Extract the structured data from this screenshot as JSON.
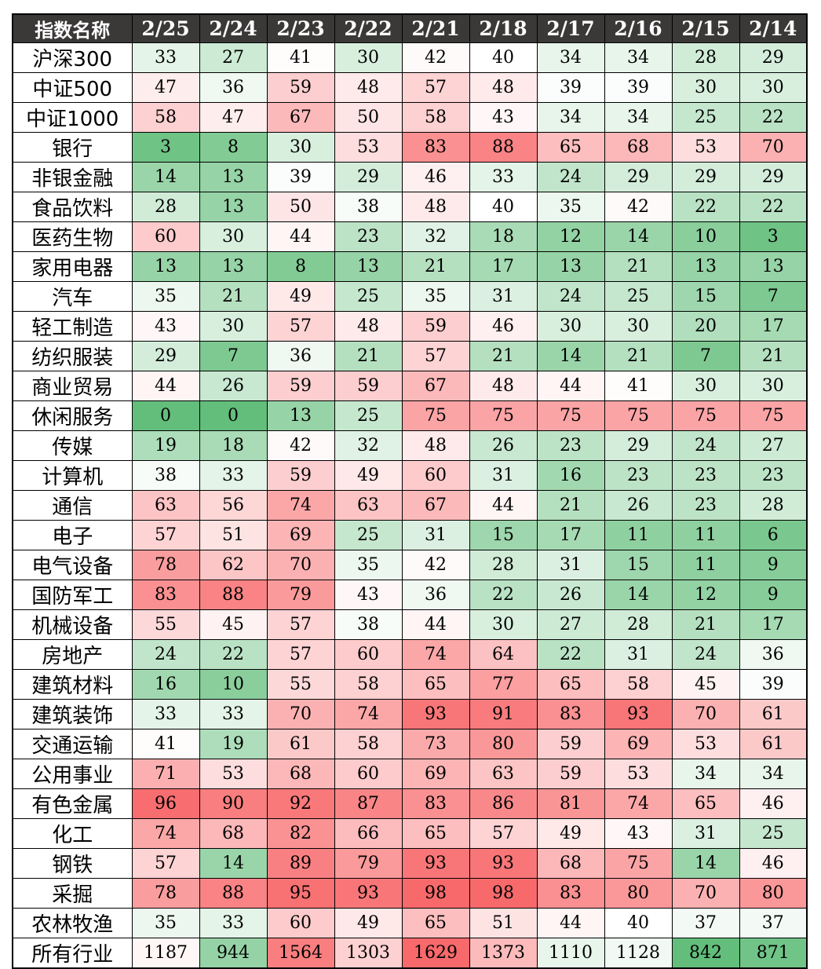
{
  "chart_data": {
    "type": "heatmap",
    "corner_label": "指数名称",
    "columns": [
      "2/25",
      "2/24",
      "2/23",
      "2/22",
      "2/21",
      "2/18",
      "2/17",
      "2/16",
      "2/15",
      "2/14"
    ],
    "rows": [
      {
        "name": "沪深300",
        "values": [
          33,
          27,
          41,
          30,
          42,
          40,
          34,
          34,
          28,
          29
        ]
      },
      {
        "name": "中证500",
        "values": [
          47,
          36,
          59,
          48,
          57,
          48,
          39,
          39,
          30,
          30
        ]
      },
      {
        "name": "中证1000",
        "values": [
          58,
          47,
          67,
          50,
          58,
          43,
          34,
          34,
          25,
          22
        ]
      },
      {
        "name": "银行",
        "values": [
          3,
          8,
          30,
          53,
          83,
          88,
          65,
          68,
          53,
          70
        ]
      },
      {
        "name": "非银金融",
        "values": [
          14,
          13,
          39,
          29,
          46,
          33,
          24,
          29,
          29,
          29
        ]
      },
      {
        "name": "食品饮料",
        "values": [
          28,
          13,
          50,
          38,
          48,
          40,
          35,
          42,
          22,
          22
        ]
      },
      {
        "name": "医药生物",
        "values": [
          60,
          30,
          44,
          23,
          32,
          18,
          12,
          14,
          10,
          3
        ]
      },
      {
        "name": "家用电器",
        "values": [
          13,
          13,
          8,
          13,
          21,
          17,
          13,
          21,
          13,
          13
        ]
      },
      {
        "name": "汽车",
        "values": [
          35,
          21,
          49,
          25,
          35,
          31,
          24,
          25,
          15,
          7
        ]
      },
      {
        "name": "轻工制造",
        "values": [
          43,
          30,
          57,
          48,
          59,
          46,
          30,
          30,
          20,
          17
        ]
      },
      {
        "name": "纺织服装",
        "values": [
          29,
          7,
          36,
          21,
          57,
          21,
          14,
          21,
          7,
          21
        ]
      },
      {
        "name": "商业贸易",
        "values": [
          44,
          26,
          59,
          59,
          67,
          48,
          44,
          41,
          30,
          30
        ]
      },
      {
        "name": "休闲服务",
        "values": [
          0,
          0,
          13,
          25,
          75,
          75,
          75,
          75,
          75,
          75
        ]
      },
      {
        "name": "传媒",
        "values": [
          19,
          18,
          42,
          32,
          48,
          26,
          23,
          29,
          24,
          27
        ]
      },
      {
        "name": "计算机",
        "values": [
          38,
          33,
          59,
          49,
          60,
          31,
          16,
          23,
          23,
          23
        ]
      },
      {
        "name": "通信",
        "values": [
          63,
          56,
          74,
          63,
          67,
          44,
          21,
          26,
          23,
          28
        ]
      },
      {
        "name": "电子",
        "values": [
          57,
          51,
          69,
          25,
          31,
          15,
          17,
          11,
          11,
          6
        ]
      },
      {
        "name": "电气设备",
        "values": [
          78,
          62,
          70,
          35,
          42,
          28,
          31,
          15,
          11,
          9
        ]
      },
      {
        "name": "国防军工",
        "values": [
          83,
          88,
          79,
          43,
          36,
          22,
          26,
          14,
          12,
          9
        ]
      },
      {
        "name": "机械设备",
        "values": [
          55,
          45,
          57,
          38,
          44,
          30,
          27,
          28,
          21,
          17
        ]
      },
      {
        "name": "房地产",
        "values": [
          24,
          22,
          57,
          60,
          74,
          64,
          22,
          31,
          24,
          36
        ]
      },
      {
        "name": "建筑材料",
        "values": [
          16,
          10,
          55,
          58,
          65,
          77,
          65,
          58,
          45,
          39
        ]
      },
      {
        "name": "建筑装饰",
        "values": [
          33,
          33,
          70,
          74,
          93,
          91,
          83,
          93,
          70,
          61
        ]
      },
      {
        "name": "交通运输",
        "values": [
          41,
          19,
          61,
          58,
          73,
          80,
          59,
          69,
          53,
          61
        ]
      },
      {
        "name": "公用事业",
        "values": [
          71,
          53,
          68,
          60,
          69,
          63,
          59,
          53,
          34,
          34
        ]
      },
      {
        "name": "有色金属",
        "values": [
          96,
          90,
          92,
          87,
          83,
          86,
          81,
          74,
          65,
          46
        ]
      },
      {
        "name": "化工",
        "values": [
          74,
          68,
          82,
          66,
          65,
          57,
          49,
          43,
          31,
          25
        ]
      },
      {
        "name": "钢铁",
        "values": [
          57,
          14,
          89,
          79,
          93,
          93,
          68,
          75,
          14,
          46
        ]
      },
      {
        "name": "采掘",
        "values": [
          78,
          88,
          95,
          93,
          98,
          98,
          83,
          80,
          70,
          80
        ]
      },
      {
        "name": "农林牧渔",
        "values": [
          35,
          33,
          60,
          49,
          65,
          51,
          44,
          40,
          37,
          37
        ]
      }
    ],
    "total_row": {
      "name": "所有行业",
      "values": [
        1187,
        944,
        1564,
        1303,
        1629,
        1373,
        1110,
        1128,
        842,
        871
      ]
    },
    "color_scale": {
      "low": "#63be7b",
      "mid": "#ffffff",
      "high": "#f8696b"
    }
  }
}
